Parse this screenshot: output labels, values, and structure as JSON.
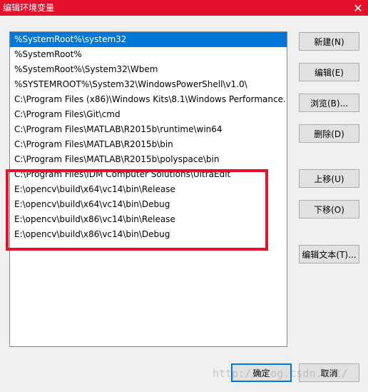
{
  "window": {
    "title": "编辑环境变量",
    "close_glyph": "✕"
  },
  "path_list": {
    "items": [
      {
        "label": "%SystemRoot%\\system32",
        "selected": true
      },
      {
        "label": "%SystemRoot%",
        "selected": false
      },
      {
        "label": "%SystemRoot%\\System32\\Wbem",
        "selected": false
      },
      {
        "label": "%SYSTEMROOT%\\System32\\WindowsPowerShell\\v1.0\\",
        "selected": false
      },
      {
        "label": "C:\\Program Files (x86)\\Windows Kits\\8.1\\Windows Performance...",
        "selected": false
      },
      {
        "label": "C:\\Program Files\\Git\\cmd",
        "selected": false
      },
      {
        "label": "C:\\Program Files\\MATLAB\\R2015b\\runtime\\win64",
        "selected": false
      },
      {
        "label": "C:\\Program Files\\MATLAB\\R2015b\\bin",
        "selected": false
      },
      {
        "label": "C:\\Program Files\\MATLAB\\R2015b\\polyspace\\bin",
        "selected": false
      },
      {
        "label": "C:\\Program Files\\IDM Computer Solutions\\UltraEdit",
        "selected": false
      },
      {
        "label": "E:\\opencv\\build\\x64\\vc14\\bin\\Release",
        "selected": false
      },
      {
        "label": "E:\\opencv\\build\\x64\\vc14\\bin\\Debug",
        "selected": false
      },
      {
        "label": "E:\\opencv\\build\\x86\\vc14\\bin\\Release",
        "selected": false
      },
      {
        "label": "E:\\opencv\\build\\x86\\vc14\\bin\\Debug",
        "selected": false
      }
    ]
  },
  "buttons": {
    "new": "新建(N)",
    "edit": "编辑(E)",
    "browse": "浏览(B)...",
    "delete": "删除(D)",
    "move_up": "上移(U)",
    "move_down": "下移(O)",
    "edit_text": "编辑文本(T)...",
    "ok": "确定",
    "cancel": "取消"
  },
  "watermark": "http://blog.csdn.net/",
  "colors": {
    "titlebar": "#e5112c",
    "selection": "#0078d7",
    "highlight_box": "#e8112a"
  }
}
